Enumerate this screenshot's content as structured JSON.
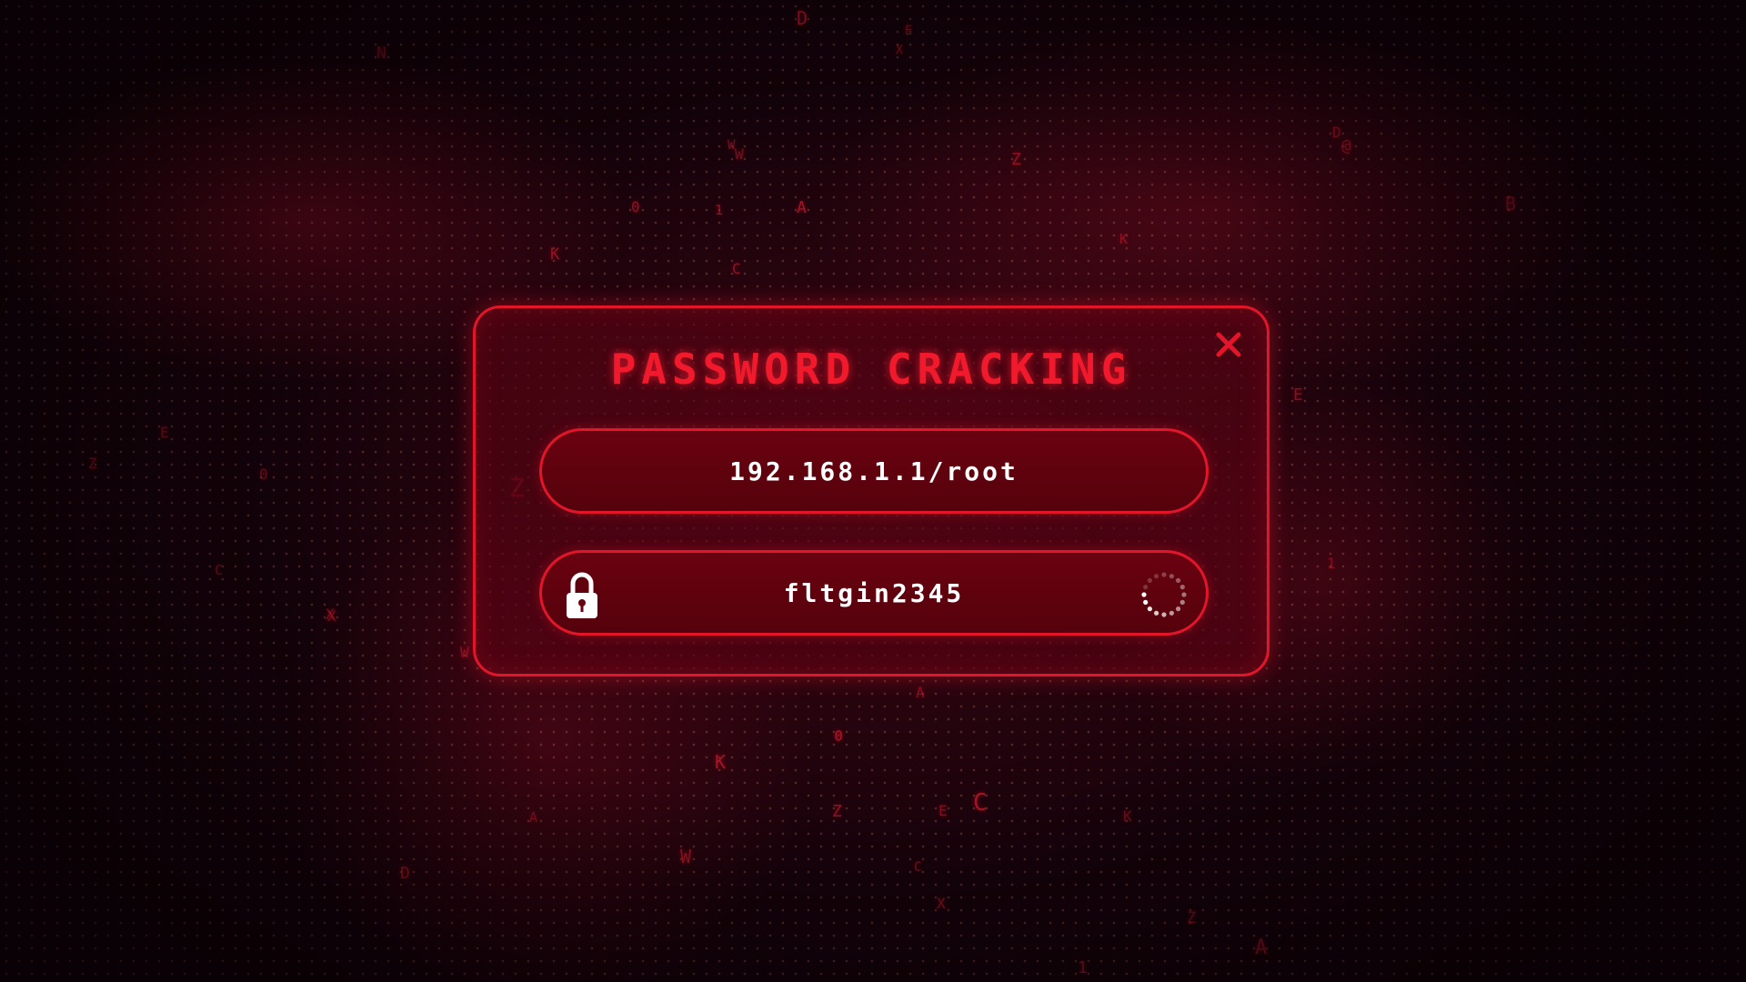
{
  "dialog": {
    "title": "PASSWORD CRACKING",
    "close_icon": "close-icon"
  },
  "host_field": {
    "value": "192.168.1.1/root"
  },
  "password_field": {
    "value": "fltgin2345",
    "lock_icon": "lock-icon",
    "spinner_icon": "loading-spinner-icon"
  },
  "colors": {
    "accent": "#e3152b",
    "field_fill": "#5c020e",
    "background": "#1a0308",
    "text": "#ffffff"
  },
  "background_glyphs": [
    "D",
    "E",
    "X",
    "N",
    "Z",
    "W",
    "0",
    "1",
    "A",
    "K",
    "C",
    "@",
    "B",
    "E",
    "Z",
    "0",
    "X",
    "W",
    "K",
    "C",
    "A",
    "Z",
    "E",
    "D",
    "1",
    "W",
    "0",
    "X",
    "K",
    "Z",
    "C",
    "A",
    "D",
    "E",
    "W",
    "0",
    "Z",
    "X",
    "K",
    "1",
    "C",
    "A"
  ]
}
